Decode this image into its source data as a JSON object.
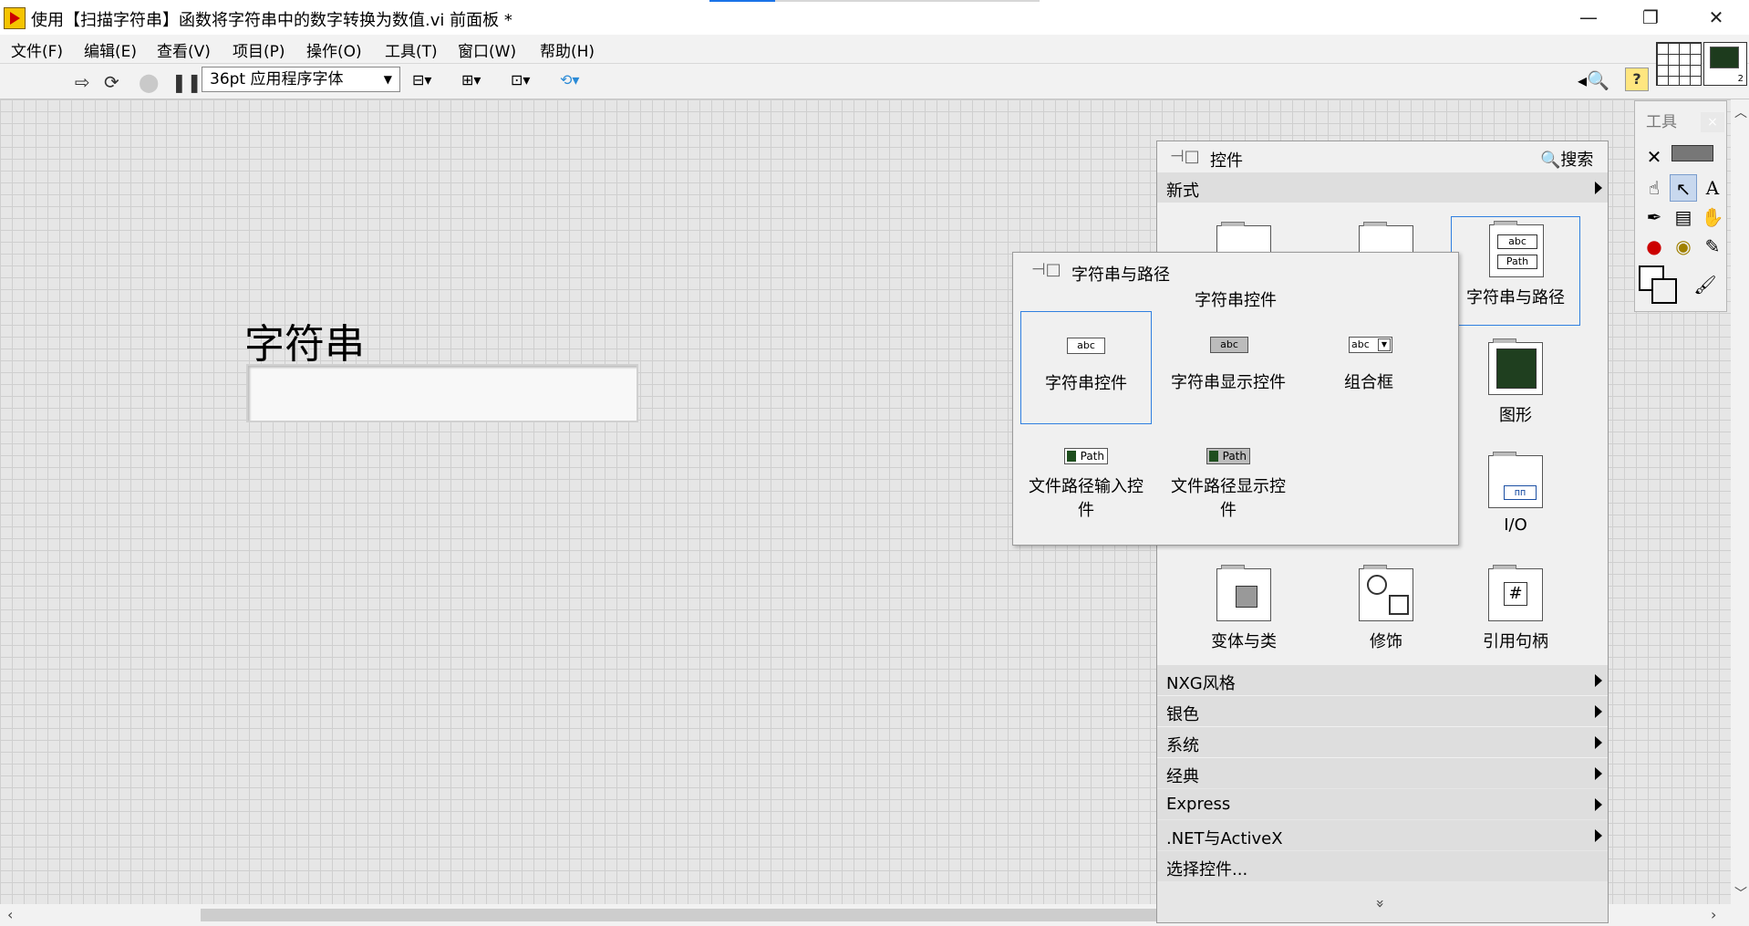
{
  "window": {
    "title": "使用【扫描字符串】函数将字符串中的数字转换为数值.vi 前面板 *",
    "minimize": "—",
    "restore": "❐",
    "close": "✕"
  },
  "menu": {
    "items": [
      {
        "label": "文件(F)"
      },
      {
        "label": "编辑(E)"
      },
      {
        "label": "查看(V)"
      },
      {
        "label": "项目(P)"
      },
      {
        "label": "操作(O)"
      },
      {
        "label": "工具(T)"
      },
      {
        "label": "窗口(W)"
      },
      {
        "label": "帮助(H)"
      }
    ]
  },
  "toolbar": {
    "font_select": "36pt 应用程序字体",
    "help_glyph": "?",
    "connector_pane_number": "2"
  },
  "front_panel": {
    "string_label": "字符串",
    "string_value": ""
  },
  "controls_palette": {
    "title": "控件",
    "search_label": "搜索",
    "category_modern": "新式",
    "tiles": [
      {
        "label": "字符串与路径"
      },
      {
        "label": "图形"
      },
      {
        "label": "I/O"
      },
      {
        "label": "变体与类"
      },
      {
        "label": "修饰"
      },
      {
        "label": "引用句柄"
      }
    ],
    "icon_texts": {
      "abc": "abc",
      "path": "Path",
      "hash": "#",
      "io": "ᴨᴨ"
    },
    "categories": [
      {
        "label": "NXG风格"
      },
      {
        "label": "银色"
      },
      {
        "label": "系统"
      },
      {
        "label": "经典"
      },
      {
        "label": "Express"
      },
      {
        "label": ".NET与ActiveX"
      },
      {
        "label": "选择控件..."
      }
    ],
    "more_glyph": "»"
  },
  "string_path_palette": {
    "title": "字符串与路径",
    "section": "字符串控件",
    "items": [
      {
        "label": "字符串控件"
      },
      {
        "label": "字符串显示控件"
      },
      {
        "label": "组合框"
      },
      {
        "label": "文件路径输入控\n件"
      },
      {
        "label": "文件路径显示控\n件"
      }
    ],
    "icon_abc": "abc",
    "icon_path": "Path"
  },
  "tools_palette": {
    "title": "工具",
    "close": "×"
  }
}
